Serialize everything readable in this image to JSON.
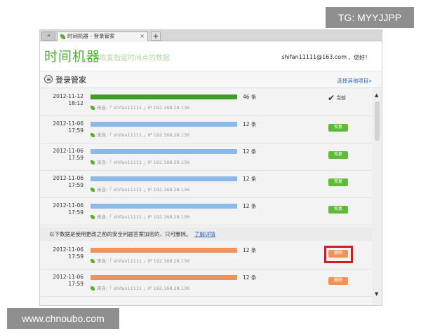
{
  "watermarks": {
    "top": "TG: MYYJJPP",
    "bottom": "www.chnoubo.com"
  },
  "browser": {
    "active_tab_title": "时间机器 - 登录管家",
    "tab_close": "×",
    "new_tab": "+"
  },
  "header": {
    "title": "时间机器",
    "subtitle": "恢复指定时间点的数据",
    "email": "shifan11111@163.com",
    "greeting": "，您好！"
  },
  "panel": {
    "title": "登录管家",
    "select_other": "选择其他项目»"
  },
  "labels": {
    "current": "当前",
    "restore": "恢复",
    "delete": "删除",
    "checkmark": "✔"
  },
  "notice": {
    "text": "以下数据是使用更改之前的安全问题答案加密的，只可删除。",
    "link": "了解详情"
  },
  "colors": {
    "current_bar": "#3f9c24",
    "restorable_bar": "#8db9e9",
    "encrypted_bar": "#f0935a",
    "highlight": "#cc1f1f"
  },
  "entries": [
    {
      "date": "2012-11-12",
      "time": "18:12",
      "count_text": "46 条",
      "count": 46,
      "source": "来自:「 shifan11111 」IP 192.168.28.136",
      "state": "current"
    },
    {
      "date": "2012-11-06",
      "time": "17:59",
      "count_text": "12 条",
      "count": 12,
      "source": "来自:「 shifan11111 」IP 192.168.28.136",
      "state": "restore"
    },
    {
      "date": "2012-11-06",
      "time": "17:59",
      "count_text": "12 条",
      "count": 12,
      "source": "来自:「 shifan11111 」IP 192.168.28.136",
      "state": "restore"
    },
    {
      "date": "2012-11-06",
      "time": "17:59",
      "count_text": "12 条",
      "count": 12,
      "source": "来自:「 shifan11111 」IP 192.168.28.136",
      "state": "restore"
    },
    {
      "date": "2012-11-06",
      "time": "17:59",
      "count_text": "12 条",
      "count": 12,
      "source": "来自:「 shifan11111 」IP 192.168.28.136",
      "state": "restore"
    }
  ],
  "encrypted_entries": [
    {
      "date": "2012-11-06",
      "time": "17:59",
      "count_text": "12 条",
      "count": 12,
      "source": "来自:「 shifan11111 」IP 192.168.28.136",
      "highlighted": true
    },
    {
      "date": "2012-11-06",
      "time": "17:59",
      "count_text": "12 条",
      "count": 12,
      "source": "来自:「 shifan11111 」IP 192.168.28.136",
      "highlighted": false
    }
  ]
}
